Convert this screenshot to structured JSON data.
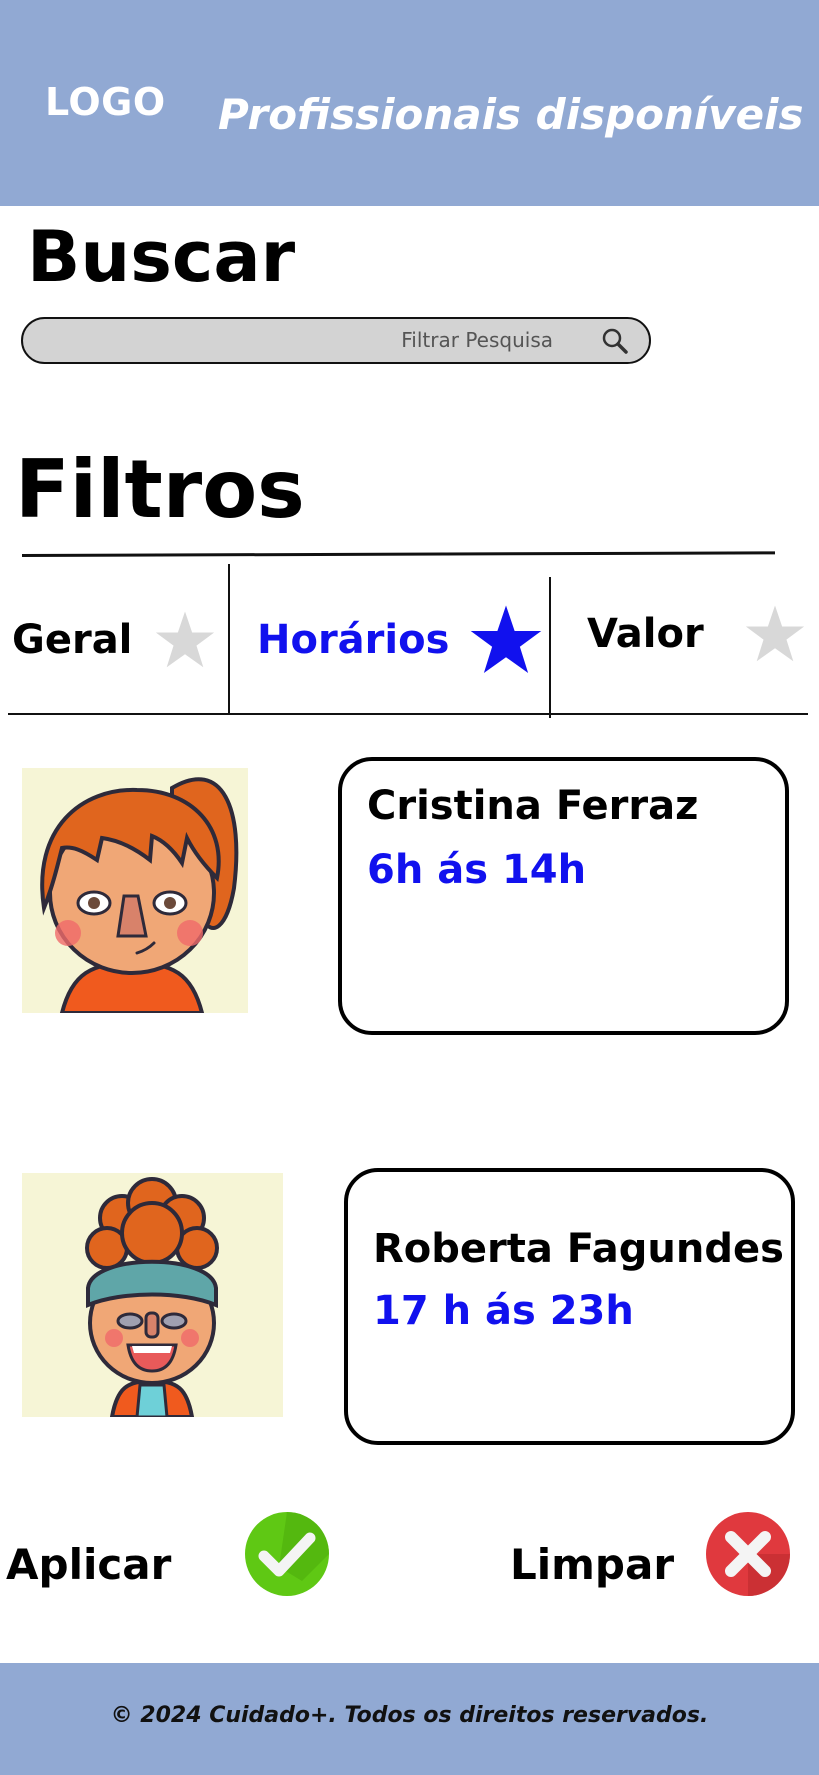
{
  "header": {
    "logo": "LOGO",
    "title": "Profissionais disponíveis"
  },
  "search": {
    "title": "Buscar",
    "placeholder": "Filtrar Pesquisa",
    "icon": "search-icon"
  },
  "filters": {
    "title": "Filtros",
    "tabs": [
      {
        "label": "Geral",
        "icon": "star-icon",
        "active": false
      },
      {
        "label": "Horários",
        "icon": "star-icon",
        "active": true
      },
      {
        "label": "Valor",
        "icon": "star-icon",
        "active": false
      }
    ]
  },
  "professionals": [
    {
      "name": "Cristina Ferraz",
      "hours": "6h ás 14h",
      "avatar": "avatar-woman-ponytail"
    },
    {
      "name": "Roberta Fagundes",
      "hours": "17 h ás 23h",
      "avatar": "avatar-woman-headband"
    }
  ],
  "actions": {
    "apply_label": "Aplicar",
    "apply_icon": "check-icon",
    "clear_label": "Limpar",
    "clear_icon": "close-icon"
  },
  "footer": {
    "text": "© 2024 Cuidado+. Todos os direitos reservados."
  },
  "colors": {
    "header_bg": "#91A9D3",
    "accent_blue": "#1111EE",
    "inactive_star": "#D8D8D8",
    "apply_green": "#5FC814",
    "clear_red": "#E0393E"
  }
}
